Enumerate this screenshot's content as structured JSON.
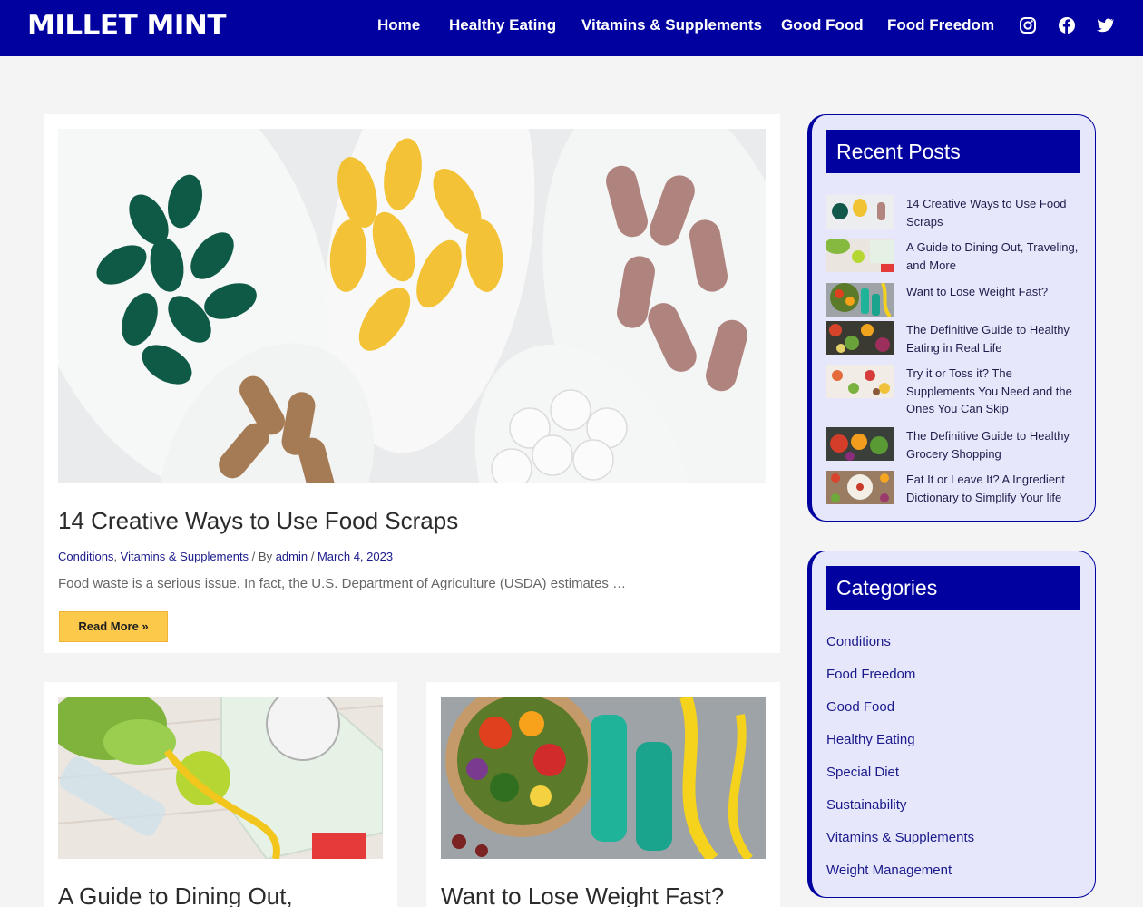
{
  "header": {
    "logo": "MILLET MINT",
    "nav": [
      {
        "label": "Home"
      },
      {
        "label": "Healthy Eating"
      },
      {
        "label": "Vitamins & Supplements"
      },
      {
        "label": "Good Food"
      },
      {
        "label": "Food Freedom"
      }
    ],
    "social_icons": [
      "instagram-icon",
      "facebook-icon",
      "twitter-icon"
    ]
  },
  "featured_post": {
    "title": "14 Creative Ways to Use Food Scraps",
    "category_1": "Conditions",
    "category_2": "Vitamins & Supplements",
    "by_label": "By",
    "author": "admin",
    "date": "March 4, 2023",
    "excerpt": "Food waste is a serious issue. In fact, the U.S. Department of Agriculture (USDA) estimates …",
    "read_more": "Read More »"
  },
  "posts": [
    {
      "title": "A Guide to Dining Out,"
    },
    {
      "title": "Want to Lose Weight Fast?"
    }
  ],
  "sidebar": {
    "recent_title": "Recent Posts",
    "recent_posts": [
      {
        "title": "14 Creative Ways to Use Food Scraps"
      },
      {
        "title": "A Guide to Dining Out, Traveling, and More"
      },
      {
        "title": "Want to Lose Weight Fast?"
      },
      {
        "title": "The Definitive Guide to Healthy Eating in Real Life"
      },
      {
        "title": "Try it or Toss it? The Supplements You Need and the Ones You Can Skip"
      },
      {
        "title": "The Definitive Guide to Healthy Grocery Shopping"
      },
      {
        "title": "Eat It or Leave It? A Ingredient Dictionary to Simplify Your life"
      }
    ],
    "categories_title": "Categories",
    "categories": [
      {
        "label": "Conditions"
      },
      {
        "label": "Food Freedom"
      },
      {
        "label": "Good Food"
      },
      {
        "label": "Healthy Eating"
      },
      {
        "label": "Special Diet"
      },
      {
        "label": "Sustainability"
      },
      {
        "label": "Vitamins & Supplements"
      },
      {
        "label": "Weight Management"
      }
    ]
  },
  "colors": {
    "brand": "#0101a0",
    "button": "#fdc94b",
    "widget_bg": "#e7e7fb",
    "link": "#1a1a8c"
  }
}
